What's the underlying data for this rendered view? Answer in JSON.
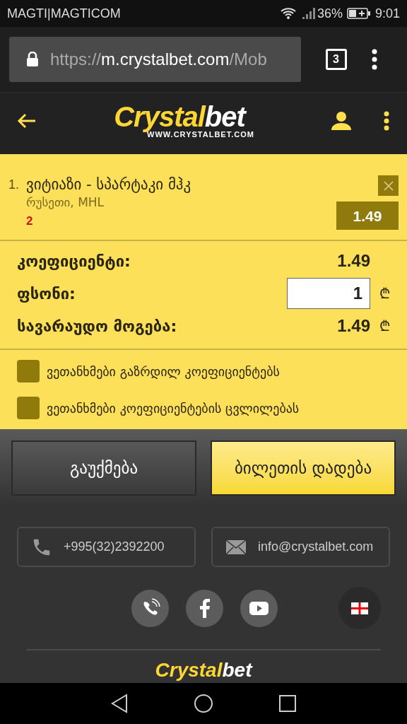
{
  "status_bar": {
    "carrier": "MAGTI|MAGTICOM",
    "battery": "36%",
    "time": "9:01"
  },
  "browser": {
    "url_scheme": "https://",
    "url_host": "m.crystalbet.com",
    "url_path": "/Mob",
    "tab_count": "3"
  },
  "header": {
    "logo_first": "Crystal",
    "logo_second": "bet",
    "logo_site": "WWW.CRYSTALBET.COM"
  },
  "bet": {
    "index": "1.",
    "match": "ვიტიაზი - სპარტაკი მჰკ",
    "league": "რუსეთი, MHL",
    "outcome": "2",
    "odds": "1.49"
  },
  "totals": [
    {
      "kind": "value",
      "label": "კოეფიციენტი:",
      "value": "1.49"
    },
    {
      "kind": "input",
      "label": "ფსონი:",
      "value": "1",
      "currency": "₾"
    },
    {
      "kind": "value",
      "label": "სავარაუდო მოგება:",
      "value": "1.49",
      "currency": "₾"
    }
  ],
  "options": [
    {
      "label": "ვეთანხმები გაზრდილ კოეფიციენტებს",
      "checked": false
    },
    {
      "label": "ვეთანხმები კოეფიციენტების ცვლილებას",
      "checked": false
    }
  ],
  "buttons": [
    {
      "kind": "secondary",
      "label": "გაუქმება"
    },
    {
      "kind": "primary",
      "label": "ბილეთის დადება"
    }
  ],
  "contacts": [
    {
      "kind": "phone",
      "text": "+995(32)2392200"
    },
    {
      "kind": "email",
      "text": "info@crystalbet.com"
    }
  ],
  "footer": {
    "logo_first": "Crystal",
    "logo_second": "bet"
  }
}
